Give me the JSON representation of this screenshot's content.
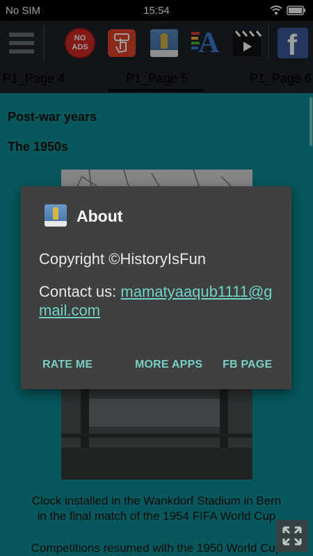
{
  "status_bar": {
    "carrier": "No SIM",
    "time": "15:54"
  },
  "toolbar": {
    "no_ads_line1": "NO",
    "no_ads_line2": "ADS",
    "facebook_letter": "f",
    "font_letter": "A"
  },
  "tabs": [
    {
      "label": "P1_Page 4"
    },
    {
      "label": "P1_Page 5"
    },
    {
      "label": "P1_Page 6"
    }
  ],
  "content": {
    "heading1": "Post-war years",
    "heading2": "The 1950s",
    "caption_line1": "Clock installed in the Wankdorf Stadium in Bern",
    "caption_line2": "in the final match of the 1954 FIFA World Cup",
    "body_line": "Competitions resumed with the 1950 World Cup"
  },
  "dialog": {
    "title": "About",
    "copyright": "Copyright ©HistoryIsFun",
    "contact_label": "Contact us: ",
    "email": "mamatyaaqub1111@gmail.com",
    "rate_button": "RATE ME",
    "more_apps_button": "MORE APPS",
    "fb_page_button": "FB PAGE"
  },
  "colors": {
    "content_bg": "#0a8f96",
    "toolbar_bg": "#1c2329",
    "dialog_bg": "#404040",
    "accent": "#77cfc3"
  }
}
